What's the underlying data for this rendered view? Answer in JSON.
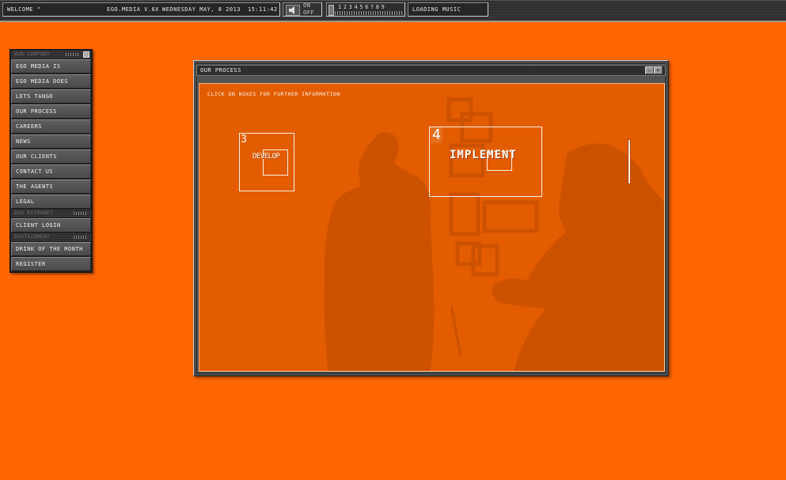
{
  "topbar": {
    "welcome": "WELCOME \"",
    "version": "EGO.MEDIA V.6X",
    "date": "WEDNESDAY MAY, 8 2013",
    "time": "15:11:42",
    "sound_on": "ON",
    "sound_off": "OFF",
    "tracks": "123456789",
    "music_status": "LOADING MUSIC"
  },
  "menu": {
    "sections": [
      {
        "title": "OUR COMPANY",
        "items": [
          "EGO MEDIA IS",
          "EGO MEDIA DOES",
          "LETS TANGO",
          "OUR PROCESS",
          "CAREERS",
          "NEWS",
          "OUR CLIENTS",
          "CONTACT US",
          "THE AGENTS",
          "LEGAL"
        ]
      },
      {
        "title": "EGO EXTRANET",
        "items": [
          "CLIENT LOGIN"
        ]
      },
      {
        "title": "EGOTAINMENT",
        "items": [
          "DRINK OF THE MONTH",
          "REGISTER"
        ]
      }
    ]
  },
  "window": {
    "title": "OUR PROCESS",
    "min_label": "—",
    "close_label": "×",
    "hint": "CLICK ON BOXES FOR FURTHER INFORMATION",
    "steps": [
      {
        "number": "3",
        "label": "DEVELOP"
      },
      {
        "number": "4",
        "label": "IMPLEMENT"
      }
    ]
  },
  "colors": {
    "background": "#ff6600",
    "content_bg": "#e35c00",
    "chrome": "#4a4a4a"
  }
}
